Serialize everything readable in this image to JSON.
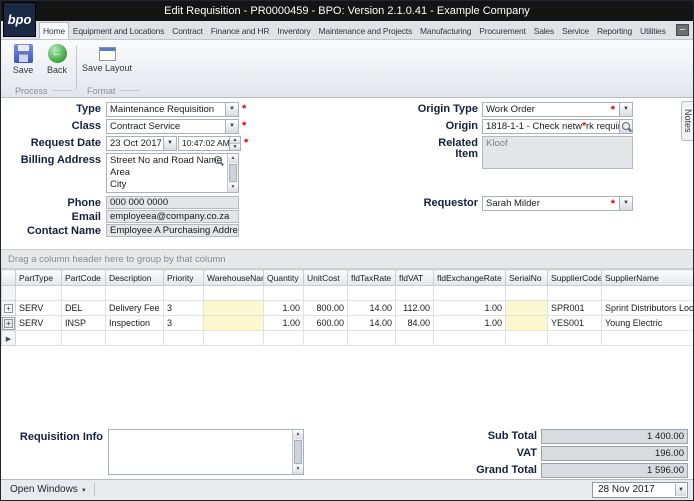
{
  "window": {
    "title": "Edit Requisition - PR0000459 - BPO: Version 2.1.0.41 - Example Company",
    "logo": "bpo"
  },
  "colors": {
    "required": "#dd0000",
    "cell_yellow": "#fbf7cf",
    "titlebar": "#141414",
    "logo_bg": "#1b2a44"
  },
  "icons": {
    "dropdown": "▼",
    "up": "▲",
    "down": "▼",
    "back": "←",
    "minimize": "–",
    "expand": "+",
    "row_marker": "▶"
  },
  "ribbon": {
    "tabs": [
      "Home",
      "Equipment and Locations",
      "Contract",
      "Finance and HR",
      "Inventory",
      "Maintenance and Projects",
      "Manufacturing",
      "Procurement",
      "Sales",
      "Service",
      "Reporting",
      "Utilities"
    ],
    "buttons": {
      "save": "Save",
      "back": "Back",
      "save_layout": "Save Layout"
    },
    "groups": {
      "process": "Process",
      "format": "Format"
    }
  },
  "form": {
    "required_marker": "*",
    "type": {
      "label": "Type",
      "value": "Maintenance Requisition"
    },
    "class": {
      "label": "Class",
      "value": "Contract Service"
    },
    "request_date": {
      "label": "Request Date",
      "date": "23 Oct 2017",
      "time": "10:47:02 AM"
    },
    "billing_address": {
      "label": "Billing Address",
      "value": "Street No and Road Name\nArea\nCity"
    },
    "phone": {
      "label": "Phone",
      "value": "000 000 0000"
    },
    "email": {
      "label": "Email",
      "value": "employeea@company.co.za"
    },
    "contact_name": {
      "label": "Contact Name",
      "value": "Employee A Purchasing Address"
    },
    "origin_type": {
      "label": "Origin Type",
      "value": "Work Order"
    },
    "origin": {
      "label": "Origin",
      "value_before": "1818-1-1 - Check netw",
      "value_after": "rk require..."
    },
    "related_item": {
      "label": "Related Item",
      "value": "Kloof"
    },
    "requestor": {
      "label": "Requestor",
      "value": "Sarah Milder"
    },
    "notes_tab": "Notes"
  },
  "grid": {
    "group_hint": "Drag a column header here to group by that column",
    "columns": [
      "PartType",
      "PartCode",
      "Description",
      "Priority",
      "WarehouseName",
      "Quantity",
      "UnitCost",
      "fldTaxRate",
      "fldVAT",
      "fldExchangeRate",
      "SerialNo",
      "SupplierCode",
      "SupplierName"
    ],
    "rows": [
      {
        "parttype": "SERV",
        "partcode": "DEL",
        "description": "Delivery Fee",
        "priority": "3",
        "warehouse": "",
        "quantity": "1.00",
        "unitcost": "800.00",
        "taxrate": "14.00",
        "vat": "112.00",
        "exchangerate": "1.00",
        "serialno": "",
        "suppliercode": "SPR001",
        "suppliername": "Sprint Distributors Local"
      },
      {
        "parttype": "SERV",
        "partcode": "INSP",
        "description": "Inspection",
        "priority": "3",
        "warehouse": "",
        "quantity": "1.00",
        "unitcost": "600.00",
        "taxrate": "14.00",
        "vat": "84.00",
        "exchangerate": "1.00",
        "serialno": "",
        "suppliercode": "YES001",
        "suppliername": "Young Electric"
      }
    ]
  },
  "footer": {
    "requisition_info_label": "Requisition Info",
    "requisition_info_value": "",
    "totals": [
      {
        "label": "Sub Total",
        "value": "1 400.00"
      },
      {
        "label": "VAT",
        "value": "196.00"
      },
      {
        "label": "Grand Total",
        "value": "1 596.00"
      }
    ]
  },
  "statusbar": {
    "open_windows": "Open Windows",
    "date": "28 Nov 2017"
  }
}
